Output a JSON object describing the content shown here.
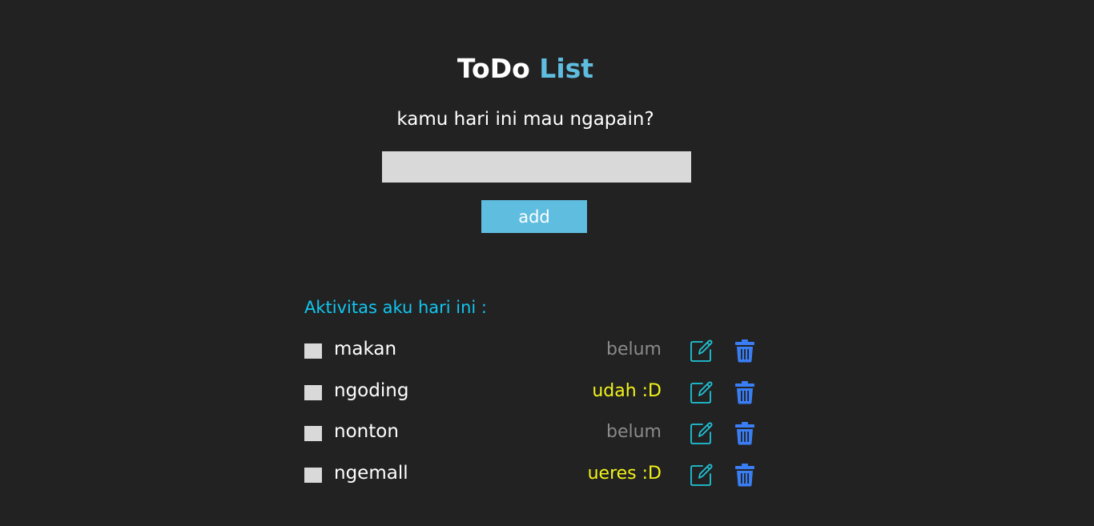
{
  "header": {
    "title_part1": "ToDo",
    "title_part2": "List",
    "subtitle": "kamu hari ini mau ngapain?"
  },
  "form": {
    "input_value": "",
    "input_placeholder": "",
    "add_label": "add"
  },
  "list": {
    "heading": "Aktivitas aku hari ini :",
    "items": [
      {
        "text": "makan",
        "status": "belum",
        "status_color": "#8a8a8a",
        "checked": false
      },
      {
        "text": "ngoding",
        "status": "udah :D",
        "status_color": "#f2f21a",
        "checked": false
      },
      {
        "text": "nonton",
        "status": "belum",
        "status_color": "#8a8a8a",
        "checked": false
      },
      {
        "text": "ngemall",
        "status": "ueres :D",
        "status_color": "#f2f21a",
        "checked": false
      }
    ]
  },
  "icons": {
    "edit": "edit-icon",
    "delete": "trash-icon"
  },
  "colors": {
    "background": "#222222",
    "accent": "#5fbde0",
    "heading_accent": "#11c6f0",
    "edit_icon": "#1fc4d8",
    "trash_icon": "#3a7ef5",
    "checkbox": "#d9d9d9"
  }
}
